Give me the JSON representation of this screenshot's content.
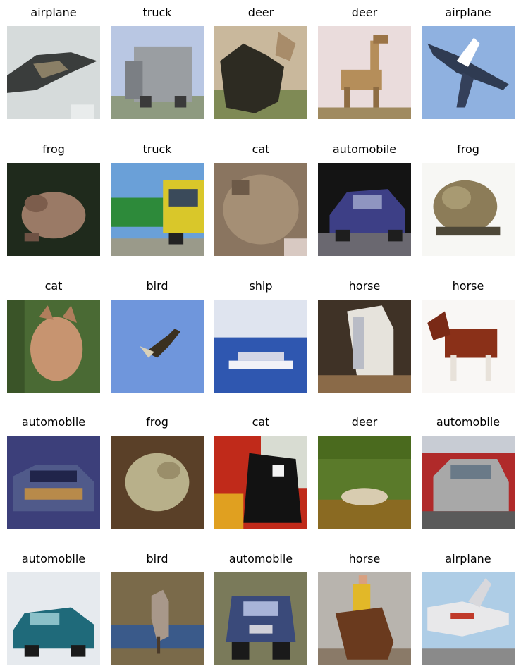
{
  "figure": {
    "images": [
      {
        "label": "airplane"
      },
      {
        "label": "truck"
      },
      {
        "label": "deer"
      },
      {
        "label": "deer"
      },
      {
        "label": "airplane"
      },
      {
        "label": "frog"
      },
      {
        "label": "truck"
      },
      {
        "label": "cat"
      },
      {
        "label": "automobile"
      },
      {
        "label": "frog"
      },
      {
        "label": "cat"
      },
      {
        "label": "bird"
      },
      {
        "label": "ship"
      },
      {
        "label": "horse"
      },
      {
        "label": "horse"
      },
      {
        "label": "automobile"
      },
      {
        "label": "frog"
      },
      {
        "label": "cat"
      },
      {
        "label": "deer"
      },
      {
        "label": "automobile"
      },
      {
        "label": "automobile"
      },
      {
        "label": "bird"
      },
      {
        "label": "automobile"
      },
      {
        "label": "horse"
      },
      {
        "label": "airplane"
      }
    ]
  }
}
